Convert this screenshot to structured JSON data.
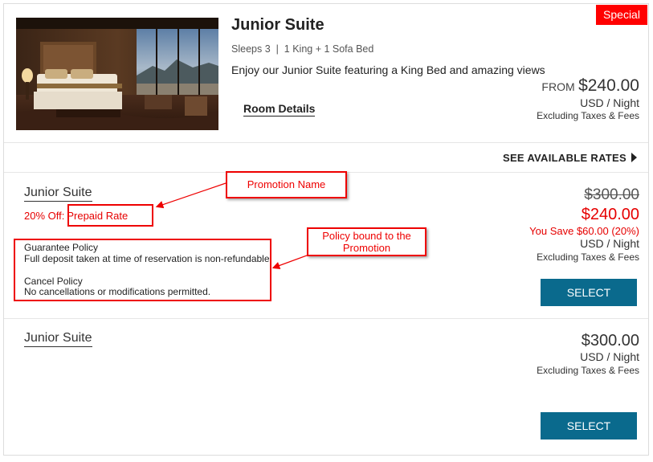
{
  "badge": {
    "label": "Special"
  },
  "room": {
    "title": "Junior Suite",
    "sleeps": "Sleeps 3  |  1 King + 1 Sofa Bed",
    "description": "Enjoy our Junior Suite featuring a King Bed and amazing views",
    "details_link": "Room Details",
    "from_label": "FROM",
    "from_price": "$240.00",
    "unit": "USD / Night",
    "taxes_note": "Excluding Taxes & Fees"
  },
  "rates_toggle": {
    "label": "SEE AVAILABLE RATES",
    "icon": "caret-right-icon"
  },
  "rates": [
    {
      "title": "Junior Suite",
      "promo_discount": "20% Off:",
      "promo_name": "Prepaid Rate",
      "guarantee_title": "Guarantee Policy",
      "guarantee_text": "Full deposit taken at time of reservation is non-refundable.",
      "cancel_title": "Cancel Policy",
      "cancel_text": "No cancellations or modifications permitted.",
      "original_price": "$300.00",
      "price": "$240.00",
      "savings": "You Save $60.00 (20%)",
      "unit": "USD / Night",
      "taxes_note": "Excluding Taxes & Fees",
      "select_label": "SELECT"
    },
    {
      "title": "Junior Suite",
      "price": "$300.00",
      "unit": "USD / Night",
      "taxes_note": "Excluding Taxes & Fees",
      "select_label": "SELECT"
    }
  ],
  "annotations": {
    "promotion_name": "Promotion Name",
    "policy_line1": "Policy bound to the",
    "policy_line2": "Promotion"
  },
  "colors": {
    "accent_red": "#e60000",
    "button_blue": "#0a6a8d",
    "badge_red": "#ff0000"
  }
}
